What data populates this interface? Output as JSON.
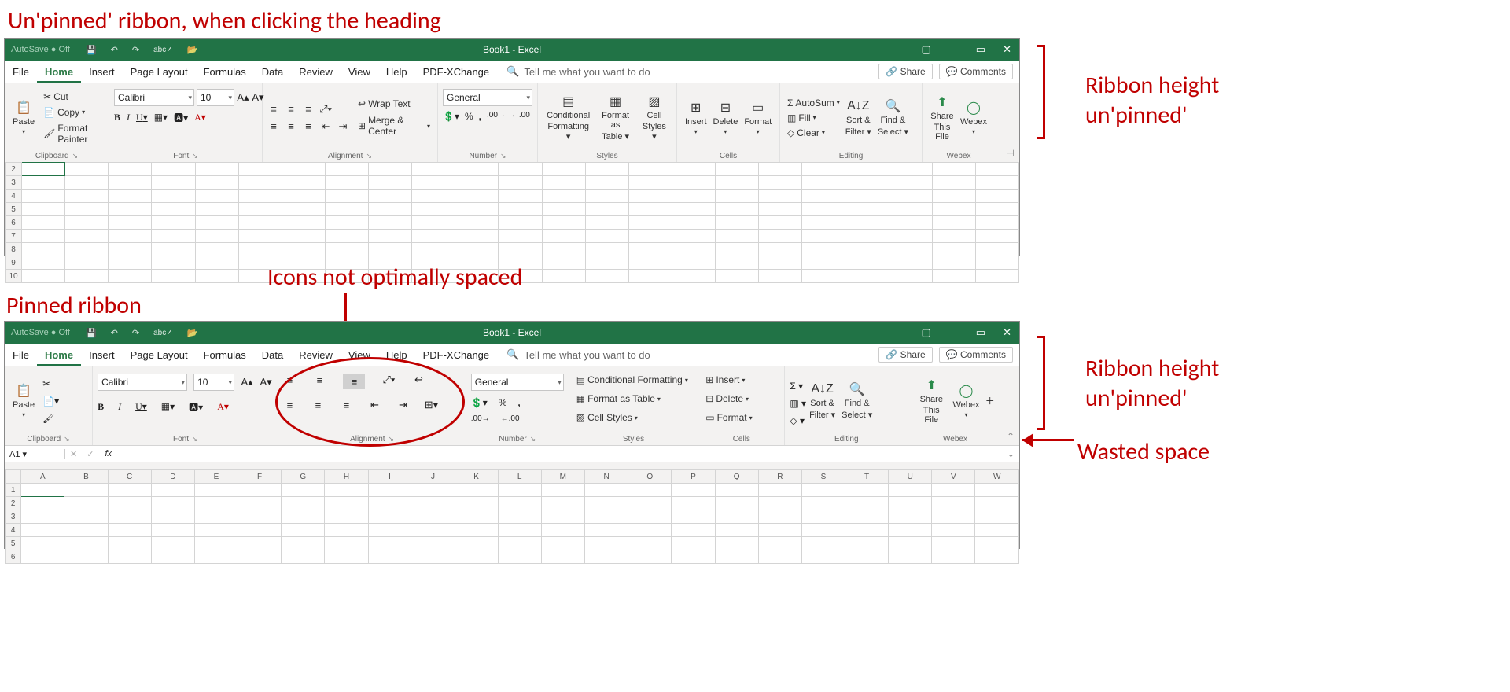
{
  "annotations": {
    "top_title": "Un'pinned' ribbon, when clicking the heading",
    "mid_title": "Icons not optimally spaced",
    "pinned_title": "Pinned ribbon",
    "right1a": "Ribbon height",
    "right1b": "un'pinned'",
    "right2a": "Ribbon height",
    "right2b": "un'pinned'",
    "right3": "Wasted space"
  },
  "title": "Book1  -  Excel",
  "autosave": "AutoSave ● Off",
  "tabs": [
    "File",
    "Home",
    "Insert",
    "Page Layout",
    "Formulas",
    "Data",
    "Review",
    "View",
    "Help",
    "PDF-XChange"
  ],
  "active_tab": "Home",
  "tellme": "Tell me what you want to do",
  "share": "Share",
  "comments": "Comments",
  "groups": {
    "clipboard": "Clipboard",
    "font": "Font",
    "alignment": "Alignment",
    "number": "Number",
    "styles": "Styles",
    "cells": "Cells",
    "editing": "Editing",
    "webex": "Webex"
  },
  "clipboard": {
    "paste": "Paste",
    "cut": "Cut",
    "copy": "Copy",
    "painter": "Format Painter"
  },
  "font": {
    "name": "Calibri",
    "size": "10",
    "bold": "B",
    "italic": "I",
    "underline": "U"
  },
  "alignment": {
    "wrap": "Wrap Text",
    "merge": "Merge & Center"
  },
  "number": {
    "format": "General"
  },
  "styles": {
    "cond": "Conditional",
    "cond2": "Formatting",
    "table": "Format as",
    "table2": "Table",
    "cell": "Cell",
    "cell2": "Styles",
    "cond_full": "Conditional Formatting",
    "table_full": "Format as Table",
    "cell_full": "Cell Styles"
  },
  "cells": {
    "insert": "Insert",
    "delete": "Delete",
    "format": "Format"
  },
  "editing": {
    "autosum": "AutoSum",
    "fill": "Fill",
    "clear": "Clear",
    "sort": "Sort &",
    "sort2": "Filter",
    "find": "Find &",
    "find2": "Select"
  },
  "webex": {
    "share": "Share",
    "share2": "This File",
    "app": "Webex"
  },
  "formula_bar": {
    "cell": "A1",
    "fx": "fx"
  },
  "row_headers1": [
    "2",
    "3",
    "4",
    "5",
    "6",
    "7",
    "8",
    "9",
    "10"
  ],
  "col_headers2": [
    "A",
    "B",
    "C",
    "D",
    "E",
    "F",
    "G",
    "H",
    "I",
    "J",
    "K",
    "L",
    "M",
    "N",
    "O",
    "P",
    "Q",
    "R",
    "S",
    "T",
    "U",
    "V",
    "W"
  ],
  "row_headers2": [
    "1",
    "2",
    "3",
    "4",
    "5",
    "6"
  ]
}
